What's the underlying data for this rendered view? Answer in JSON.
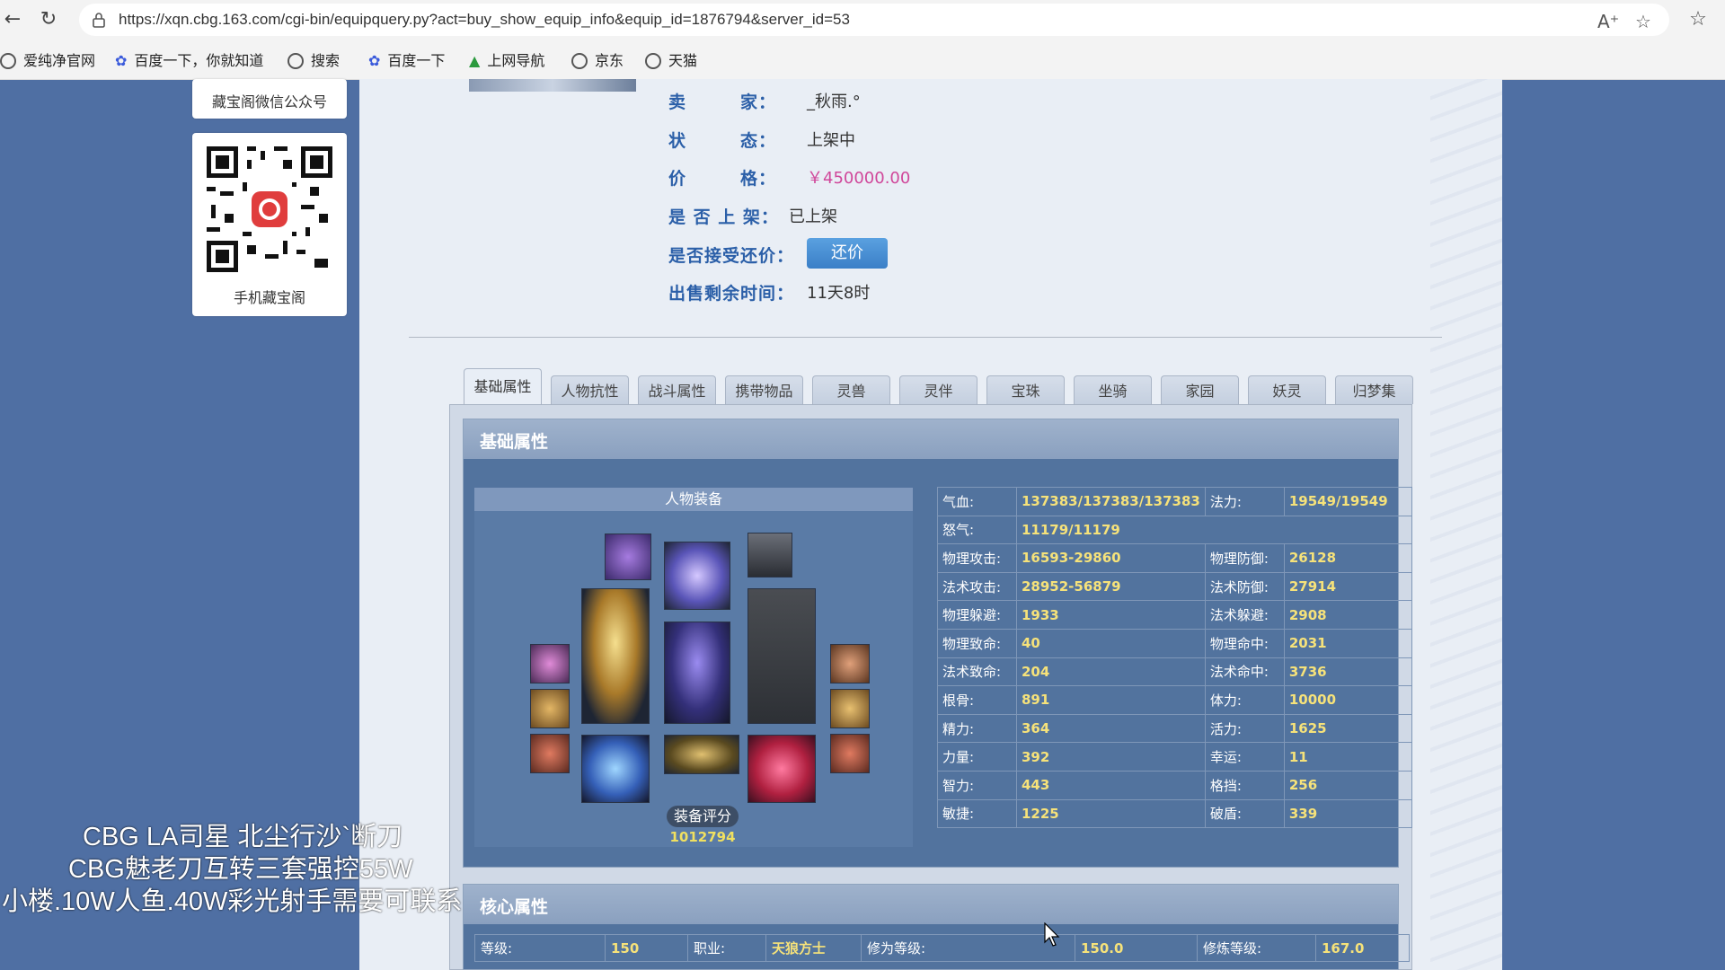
{
  "browser": {
    "url": "https://xqn.cbg.163.com/cgi-bin/equipquery.py?act=buy_show_equip_info&equip_id=1876794&server_id=53",
    "bookmarks": [
      "爱纯净官网",
      "百度一下，你就知道",
      "搜索",
      "百度一下",
      "上网导航",
      "京东",
      "天猫"
    ]
  },
  "sidebar": {
    "wechat_label": "藏宝阁微信公众号",
    "mobile_label": "手机藏宝阁"
  },
  "info": {
    "seller_label": "卖　　　家：",
    "seller_value": "_秋雨.°",
    "status_label": "状　　　态：",
    "status_value": "上架中",
    "price_label": "价　　　格：",
    "price_value": "￥450000.00",
    "listed_label": "是 否 上 架：",
    "listed_value": "已上架",
    "counter_label": "是否接受还价：",
    "counter_button": "还价",
    "remaining_label": "出售剩余时间：",
    "remaining_value": "11天8时"
  },
  "tabs": [
    "基础属性",
    "人物抗性",
    "战斗属性",
    "携带物品",
    "灵兽",
    "灵伴",
    "宝珠",
    "坐骑",
    "家园",
    "妖灵",
    "归梦集"
  ],
  "basic_panel": {
    "title": "基础属性",
    "equip_title": "人物装备",
    "score_label": "装备评分",
    "score_value": "1012794"
  },
  "stats": {
    "row1": [
      {
        "k": "气血:",
        "v": "137383/137383/137383"
      },
      {
        "k": "法力:",
        "v": "19549/19549"
      }
    ],
    "rage": {
      "k": "怒气:",
      "v": "11179/11179"
    },
    "rows": [
      [
        {
          "k": "物理攻击:",
          "v": "16593-29860"
        },
        {
          "k": "物理防御:",
          "v": "26128"
        }
      ],
      [
        {
          "k": "法术攻击:",
          "v": "28952-56879"
        },
        {
          "k": "法术防御:",
          "v": "27914"
        }
      ],
      [
        {
          "k": "物理躲避:",
          "v": "1933"
        },
        {
          "k": "法术躲避:",
          "v": "2908"
        }
      ],
      [
        {
          "k": "物理致命:",
          "v": "40"
        },
        {
          "k": "物理命中:",
          "v": "2031"
        }
      ],
      [
        {
          "k": "法术致命:",
          "v": "204"
        },
        {
          "k": "法术命中:",
          "v": "3736"
        }
      ],
      [
        {
          "k": "根骨:",
          "v": "891"
        },
        {
          "k": "体力:",
          "v": "10000"
        }
      ],
      [
        {
          "k": "精力:",
          "v": "364"
        },
        {
          "k": "活力:",
          "v": "1625"
        }
      ],
      [
        {
          "k": "力量:",
          "v": "392"
        },
        {
          "k": "幸运:",
          "v": "11"
        }
      ],
      [
        {
          "k": "智力:",
          "v": "443"
        },
        {
          "k": "格挡:",
          "v": "256"
        }
      ],
      [
        {
          "k": "敏捷:",
          "v": "1225"
        },
        {
          "k": "破盾:",
          "v": "339"
        }
      ]
    ]
  },
  "core_panel": {
    "title": "核心属性",
    "cells": [
      {
        "k": "等级:",
        "v": "150"
      },
      {
        "k": "职业:",
        "v": "天狼方士"
      },
      {
        "k": "修为等级:",
        "v": "150.0"
      },
      {
        "k": "修炼等级:",
        "v": "167.0"
      }
    ]
  },
  "overlay": {
    "line1": "CBG LA司星 北尘行沙`断刀",
    "line2": "CBG魅老刀互转三套强控55W",
    "line3": "小楼.10W人鱼.40W彩光射手需要可联系"
  }
}
